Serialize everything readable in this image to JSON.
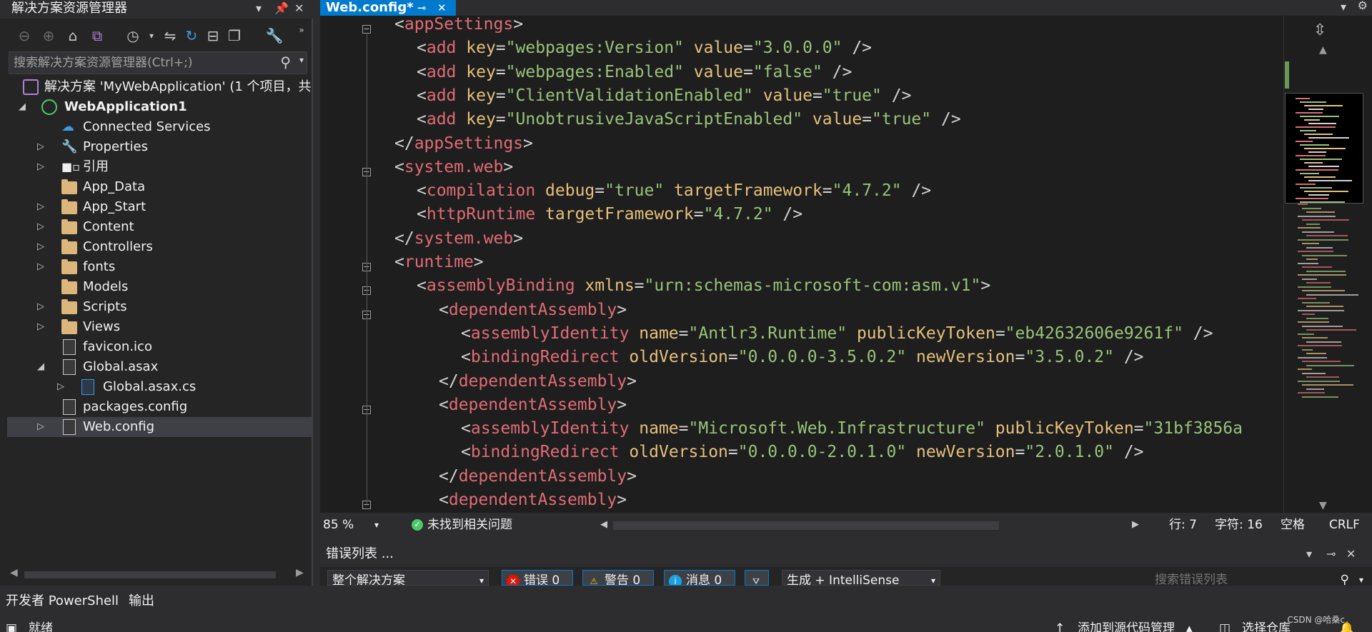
{
  "solution_explorer": {
    "title": "解决方案资源管理器",
    "search_placeholder": "搜索解决方案资源管理器(Ctrl+;)",
    "items": [
      {
        "label": "解决方案 'MyWebApplication' (1 个项目，共",
        "icon": "solution-icon"
      },
      {
        "label": "WebApplication1",
        "icon": "web-project-icon"
      },
      {
        "label": "Connected Services",
        "icon": "connected-services-icon"
      },
      {
        "label": "Properties",
        "icon": "wrench-icon"
      },
      {
        "label": "引用",
        "icon": "references-icon"
      },
      {
        "label": "App_Data",
        "icon": "folder-icon"
      },
      {
        "label": "App_Start",
        "icon": "folder-icon"
      },
      {
        "label": "Content",
        "icon": "folder-icon"
      },
      {
        "label": "Controllers",
        "icon": "folder-icon"
      },
      {
        "label": "fonts",
        "icon": "folder-icon"
      },
      {
        "label": "Models",
        "icon": "folder-icon"
      },
      {
        "label": "Scripts",
        "icon": "folder-icon"
      },
      {
        "label": "Views",
        "icon": "folder-icon"
      },
      {
        "label": "favicon.ico",
        "icon": "image-file-icon"
      },
      {
        "label": "Global.asax",
        "icon": "config-file-icon"
      },
      {
        "label": "Global.asax.cs",
        "icon": "cs-file-icon"
      },
      {
        "label": "packages.config",
        "icon": "config-file-icon"
      },
      {
        "label": "Web.config",
        "icon": "config-file-icon"
      }
    ]
  },
  "editor": {
    "tab_label": "Web.config*",
    "code_lines": [
      [
        "<",
        "appSettings",
        ">"
      ],
      [
        "<",
        "add",
        " key",
        "=",
        "\"webpages:Version\"",
        " value",
        "=",
        "\"3.0.0.0\"",
        " />"
      ],
      [
        "<",
        "add",
        " key",
        "=",
        "\"webpages:Enabled\"",
        " value",
        "=",
        "\"false\"",
        " />"
      ],
      [
        "<",
        "add",
        " key",
        "=",
        "\"ClientValidationEnabled\"",
        " value",
        "=",
        "\"true\"",
        " />"
      ],
      [
        "<",
        "add",
        " key",
        "=",
        "\"UnobtrusiveJavaScriptEnabled\"",
        " value",
        "=",
        "\"true\"",
        " />"
      ],
      [
        "</",
        "appSettings",
        ">"
      ],
      [
        "<",
        "system.web",
        ">"
      ],
      [
        "<",
        "compilation",
        " debug",
        "=",
        "\"true\"",
        " targetFramework",
        "=",
        "\"4.7.2\"",
        " />"
      ],
      [
        "<",
        "httpRuntime",
        " targetFramework",
        "=",
        "\"4.7.2\"",
        " />"
      ],
      [
        "</",
        "system.web",
        ">"
      ],
      [
        "<",
        "runtime",
        ">"
      ],
      [
        "<",
        "assemblyBinding",
        " xmlns",
        "=",
        "\"urn:schemas-microsoft-com:asm.v1\"",
        ">"
      ],
      [
        "<",
        "dependentAssembly",
        ">"
      ],
      [
        "<",
        "assemblyIdentity",
        " name",
        "=",
        "\"Antlr3.Runtime\"",
        " publicKeyToken",
        "=",
        "\"eb42632606e9261f\"",
        " />"
      ],
      [
        "<",
        "bindingRedirect",
        " oldVersion",
        "=",
        "\"0.0.0.0-3.5.0.2\"",
        " newVersion",
        "=",
        "\"3.5.0.2\"",
        " />"
      ],
      [
        "</",
        "dependentAssembly",
        ">"
      ],
      [
        "<",
        "dependentAssembly",
        ">"
      ],
      [
        "<",
        "assemblyIdentity",
        " name",
        "=",
        "\"Microsoft.Web.Infrastructure\"",
        " publicKeyToken",
        "=",
        "\"31bf3856a"
      ],
      [
        "<",
        "bindingRedirect",
        " oldVersion",
        "=",
        "\"0.0.0.0-2.0.1.0\"",
        " newVersion",
        "=",
        "\"2.0.1.0\"",
        " />"
      ],
      [
        "</",
        "dependentAssembly",
        ">"
      ],
      [
        "<",
        "dependentAssembly",
        ">"
      ]
    ],
    "zoom": "85 %",
    "issues": "未找到相关问题",
    "line": "行: 7",
    "char": "字符: 16",
    "whitespace": "空格",
    "eol": "CRLF"
  },
  "error_list": {
    "title": "错误列表 ...",
    "scope": "整个解决方案",
    "errors": "错误 0",
    "warnings": "警告 0",
    "messages": "消息 0",
    "build_filter": "生成 + IntelliSense",
    "search_placeholder": "搜索错误列表"
  },
  "bottom_tabs": [
    "开发者 PowerShell",
    "输出"
  ],
  "status_bar": {
    "ready": "就绪",
    "add_source_control": "添加到源代码管理",
    "select_repo": "选择仓库"
  },
  "watermark": "CSDN @哈桑c",
  "colors": {
    "accent": "#007acc",
    "background": "#1e1e1e",
    "panel": "#252526",
    "chrome": "#2d2d30"
  }
}
